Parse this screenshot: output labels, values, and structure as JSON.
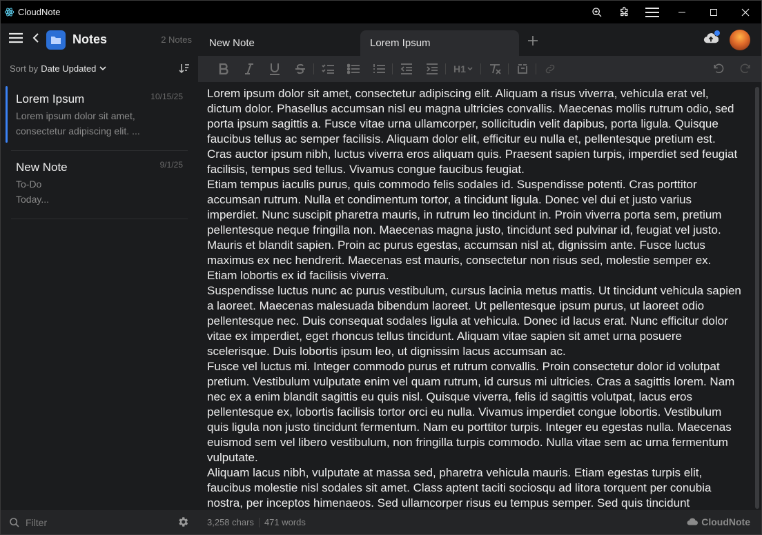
{
  "app": {
    "title": "CloudNote",
    "brand": "CloudNote"
  },
  "sidebar": {
    "title": "Notes",
    "count": "2 Notes",
    "sort_label": "Sort by",
    "sort_value": "Date Updated",
    "filter_placeholder": "Filter",
    "notes": [
      {
        "title": "Lorem Ipsum",
        "date": "10/15/25",
        "line1": "Lorem ipsum dolor sit amet,",
        "line2": "consectetur adipiscing elit. ...",
        "active": true
      },
      {
        "title": "New Note",
        "date": "9/1/25",
        "line1": "To-Do",
        "line2": "Today...",
        "active": false
      }
    ]
  },
  "tabs": [
    {
      "label": "New Note",
      "active": false
    },
    {
      "label": "Lorem Ipsum",
      "active": true
    }
  ],
  "toolbar": {
    "heading_label": "H1"
  },
  "editor": {
    "paragraphs": [
      "Lorem ipsum dolor sit amet, consectetur adipiscing elit. Aliquam a risus viverra, vehicula erat vel, dictum dolor. Phasellus accumsan nisl eu magna ultricies convallis. Maecenas mollis rutrum odio, sed porta ipsum sagittis a. Fusce vitae urna ullamcorper, sollicitudin velit dapibus, porta ligula. Quisque faucibus tellus ac semper facilisis. Aliquam dolor elit, efficitur eu nulla et, pellentesque pretium est. Cras auctor ipsum nibh, luctus viverra eros aliquam quis. Praesent sapien turpis, imperdiet sed feugiat facilisis, tempus sed tellus. Vivamus congue faucibus feugiat.",
      "Etiam tempus iaculis purus, quis commodo felis sodales id. Suspendisse potenti. Cras porttitor accumsan rutrum. Nulla et condimentum tortor, a tincidunt ligula. Donec vel dui et justo varius imperdiet. Nunc suscipit pharetra mauris, in rutrum leo tincidunt in. Proin viverra porta sem, pretium pellentesque neque fringilla non. Maecenas magna justo, tincidunt sed pulvinar id, feugiat vel justo. Mauris et blandit sapien. Proin ac purus egestas, accumsan nisl at, dignissim ante. Fusce luctus maximus ex nec hendrerit. Maecenas est mauris, consectetur non risus sed, molestie semper ex. Etiam lobortis ex id facilisis viverra.",
      "Suspendisse luctus nunc ac purus vestibulum, cursus lacinia metus mattis. Ut tincidunt vehicula sapien a laoreet. Maecenas malesuada bibendum laoreet. Ut pellentesque ipsum purus, ut laoreet odio pellentesque nec. Duis consequat sodales ligula at vehicula. Donec id lacus erat. Nunc efficitur dolor vitae ex imperdiet, eget rhoncus tellus tincidunt. Aliquam vitae sapien sit amet urna posuere scelerisque. Duis lobortis ipsum leo, ut dignissim lacus accumsan ac.",
      "Fusce vel luctus mi. Integer commodo purus et rutrum convallis. Proin consectetur dolor id volutpat pretium. Vestibulum vulputate enim vel quam rutrum, id cursus mi ultricies. Cras a sagittis lorem. Nam nec ex a enim blandit sagittis eu quis nisl. Quisque viverra, felis id sagittis volutpat, lacus eros pellentesque ex, lobortis facilisis tortor orci eu nulla. Vivamus imperdiet congue lobortis. Vestibulum quis ligula non justo tincidunt fermentum. Nam eu porttitor turpis. Integer eu egestas nulla. Maecenas euismod sem vel libero vestibulum, non fringilla turpis commodo. Nulla vitae sem ac urna fermentum vulputate.",
      "Aliquam lacus nibh, vulputate at massa sed, pharetra vehicula mauris. Etiam egestas turpis elit, faucibus molestie nisl sodales sit amet. Class aptent taciti sociosqu ad litora torquent per conubia nostra, per inceptos himenaeos. Sed ullamcorper risus eu tempus semper. Sed quis tincidunt"
    ]
  },
  "status": {
    "chars": "3,258 chars",
    "words": "471 words"
  },
  "colors": {
    "accent": "#3b82f6",
    "folder": "#2b6fd6",
    "background": "#1b1c1e",
    "toolbar": "#2b2c2f"
  }
}
